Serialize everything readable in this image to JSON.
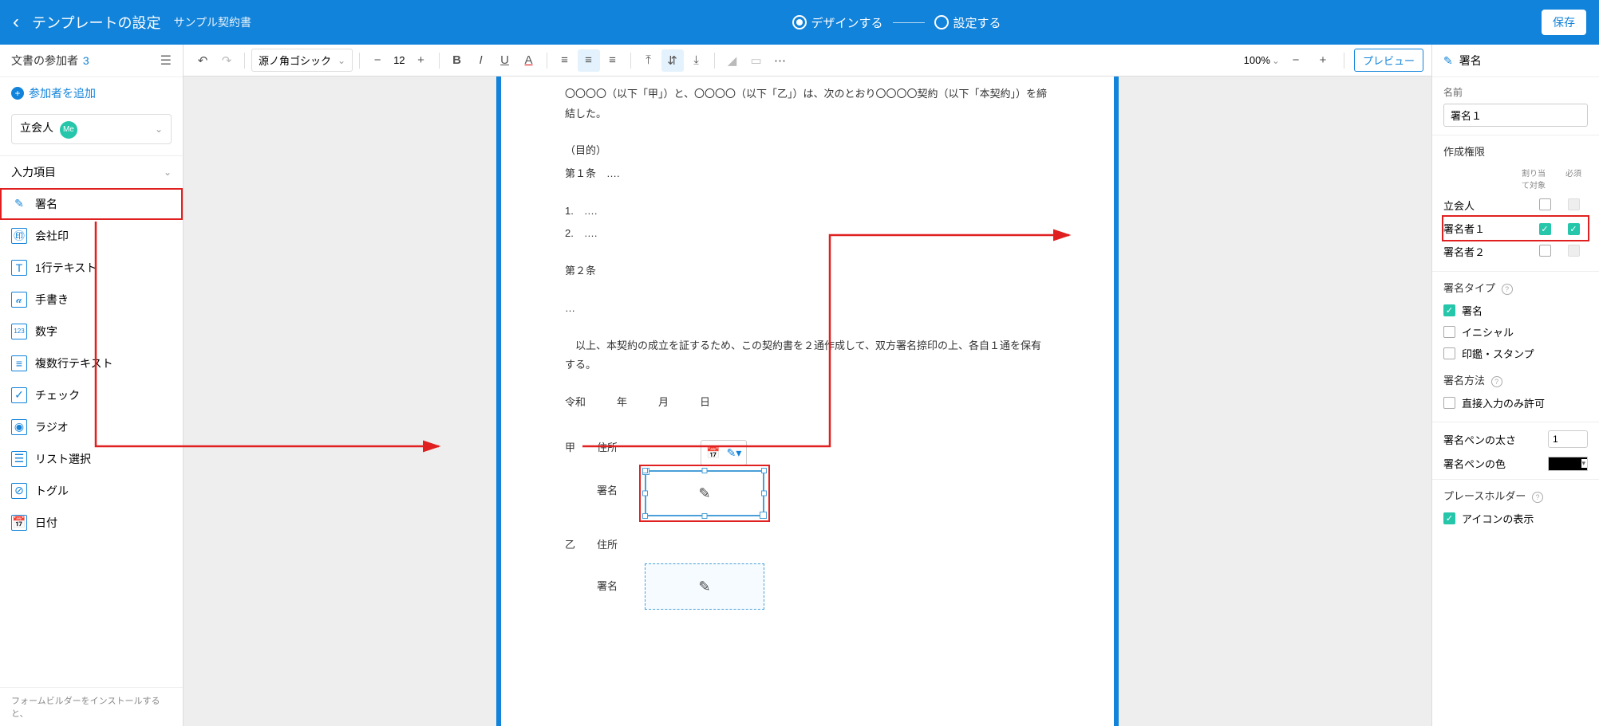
{
  "header": {
    "title": "テンプレートの設定",
    "subtitle": "サンプル契約書",
    "step1": "デザインする",
    "step2": "設定する",
    "save": "保存"
  },
  "left": {
    "participants_title": "文書の参加者",
    "participants_count": "3",
    "add_participant": "参加者を追加",
    "observer": "立会人",
    "me_badge": "Me",
    "input_items_title": "入力項目",
    "items": [
      {
        "icon": "✎",
        "label": "署名",
        "highlighted": true
      },
      {
        "icon": "㊞",
        "label": "会社印"
      },
      {
        "icon": "T",
        "label": "1行テキスト"
      },
      {
        "icon": "𝒶",
        "label": "手書き"
      },
      {
        "icon": "123",
        "label": "数字"
      },
      {
        "icon": "≡",
        "label": "複数行テキスト"
      },
      {
        "icon": "✓",
        "label": "チェック"
      },
      {
        "icon": "◉",
        "label": "ラジオ"
      },
      {
        "icon": "☰",
        "label": "リスト選択"
      },
      {
        "icon": "⊘",
        "label": "トグル"
      },
      {
        "icon": "📅",
        "label": "日付"
      }
    ],
    "footer": "フォームビルダーをインストールすると、"
  },
  "toolbar": {
    "font": "源ノ角ゴシック",
    "font_size": "12",
    "zoom": "100%",
    "preview": "プレビュー"
  },
  "document": {
    "line1": "〇〇〇〇（以下「甲」）と、〇〇〇〇（以下「乙」）は、次のとおり〇〇〇〇契約（以下「本契約」）を締結した。",
    "purpose": "（目的）",
    "art1": "第１条　….",
    "li1": "1.　….",
    "li2": "2.　….",
    "art2": "第２条",
    "ellipsis": "…",
    "closing": "　以上、本契約の成立を証するため、この契約書を２通作成して、双方署名捺印の上、各自１通を保有する。",
    "date": "令和　　　年　　　月　　　日",
    "kou": "甲",
    "otsu": "乙",
    "addr": "住所",
    "sig": "署名"
  },
  "right": {
    "title": "署名",
    "name_label": "名前",
    "name_value": "署名１",
    "perm_title": "作成権限",
    "perm_head_assign": "割り当て対象",
    "perm_head_required": "必須",
    "perm_rows": [
      {
        "name": "立会人",
        "assign": false,
        "required": "disabled"
      },
      {
        "name": "署名者１",
        "assign": true,
        "required": true,
        "highlighted": true
      },
      {
        "name": "署名者２",
        "assign": false,
        "required": "disabled"
      }
    ],
    "sig_type_title": "署名タイプ",
    "sig_types": [
      {
        "label": "署名",
        "checked": true
      },
      {
        "label": "イニシャル",
        "checked": false
      },
      {
        "label": "印鑑・スタンプ",
        "checked": false
      }
    ],
    "sig_method_title": "署名方法",
    "sig_method_direct": "直接入力のみ許可",
    "pen_width_label": "署名ペンの太さ",
    "pen_width_value": "1",
    "pen_color_label": "署名ペンの色",
    "placeholder_title": "プレースホルダー",
    "placeholder_icon": "アイコンの表示"
  }
}
